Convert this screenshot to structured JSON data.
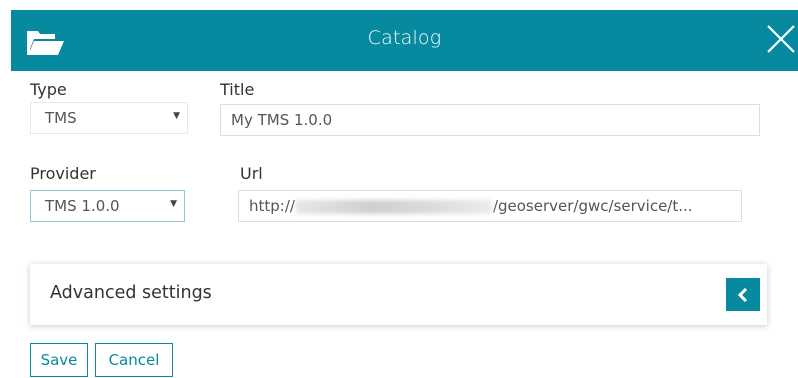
{
  "header": {
    "title": "Catalog",
    "color": "#078aa0",
    "left_icon": "folder-open-icon",
    "right_icon": "close-icon"
  },
  "form": {
    "type": {
      "label": "Type",
      "value": "TMS"
    },
    "title": {
      "label": "Title",
      "value": "My TMS 1.0.0"
    },
    "provider": {
      "label": "Provider",
      "value": "TMS 1.0.0"
    },
    "url": {
      "label": "Url",
      "prefix": "http://",
      "suffix": "/geoserver/gwc/service/t..."
    }
  },
  "advanced": {
    "label": "Advanced settings",
    "toggle_icon": "chevron-left-icon"
  },
  "buttons": {
    "save": "Save",
    "cancel": "Cancel"
  }
}
